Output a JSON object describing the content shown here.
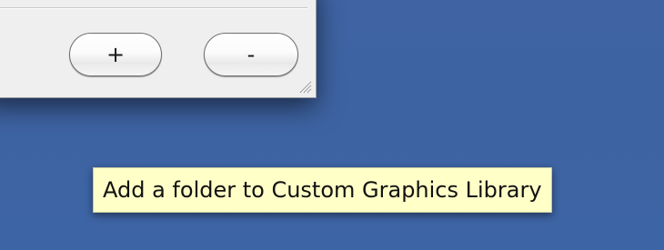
{
  "panel": {
    "add_button": {
      "label": "+"
    },
    "remove_button": {
      "label": "-"
    }
  },
  "tooltip": {
    "text": "Add a folder to Custom Graphics Library"
  },
  "colors": {
    "desktop": "#3f63a3",
    "panel_bg": "#efefef",
    "tooltip_bg": "#ffffc7"
  }
}
